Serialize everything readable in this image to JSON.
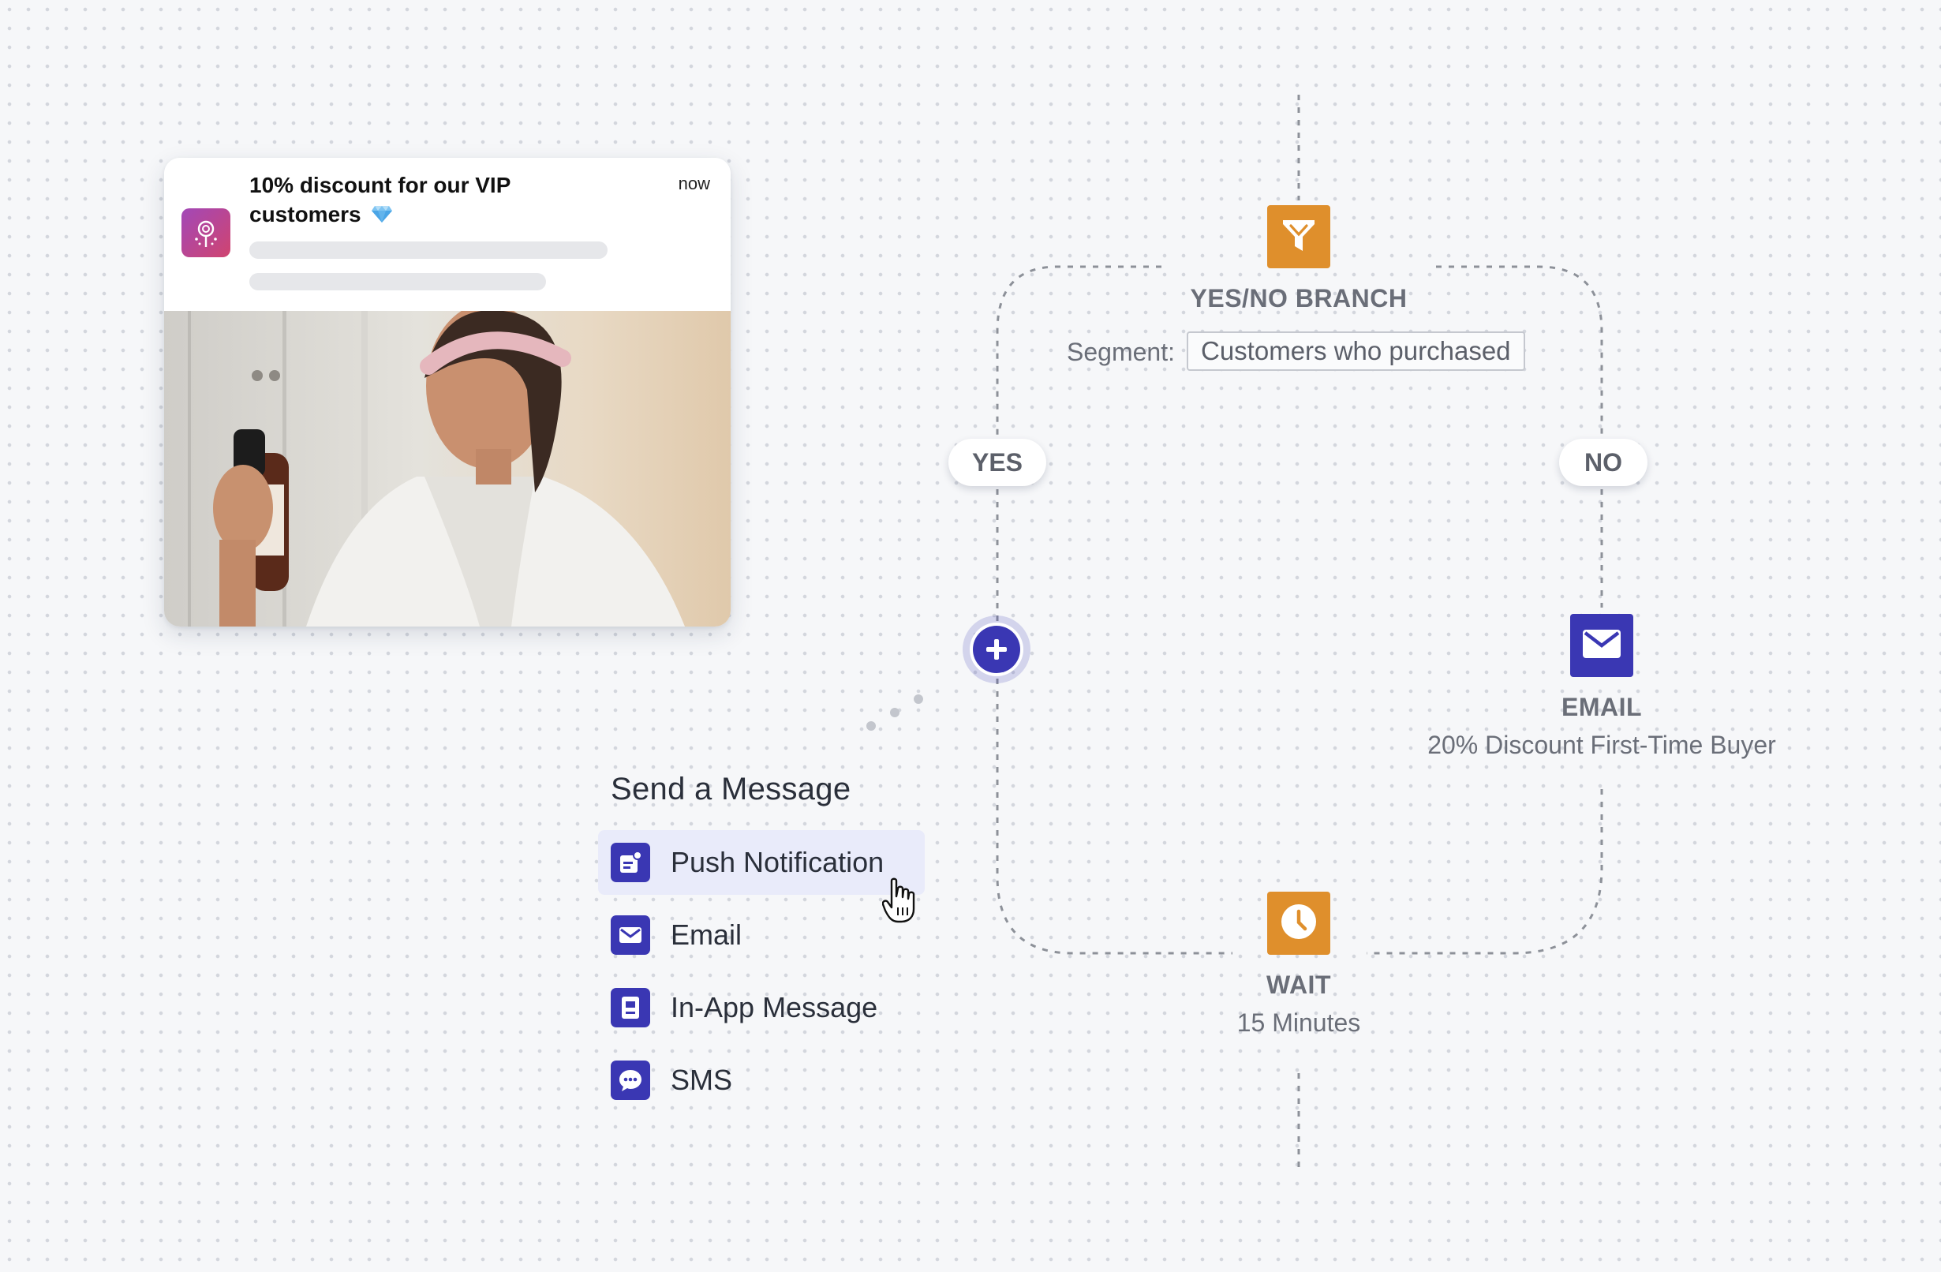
{
  "notification": {
    "title": "10% discount for our VIP customers",
    "time": "now"
  },
  "send_menu": {
    "title": "Send a Message",
    "items": [
      {
        "label": "Push Notification",
        "icon": "push-notification-icon",
        "active": true
      },
      {
        "label": "Email",
        "icon": "envelope-icon",
        "active": false
      },
      {
        "label": "In-App Message",
        "icon": "in-app-message-icon",
        "active": false
      },
      {
        "label": "SMS",
        "icon": "chat-bubble-icon",
        "active": false
      }
    ]
  },
  "flow": {
    "branch": {
      "title": "YES/NO BRANCH",
      "segment_label": "Segment:",
      "segment_value": "Customers who purchased",
      "icon": "filter-icon"
    },
    "yes_label": "YES",
    "no_label": "NO",
    "email_node": {
      "title": "EMAIL",
      "subtitle": "20% Discount First-Time Buyer",
      "icon": "envelope-icon"
    },
    "wait_node": {
      "title": "WAIT",
      "subtitle": "15 Minutes",
      "icon": "clock-icon"
    }
  },
  "colors": {
    "accent": "#3a37b3",
    "node_orange": "#df8f2c",
    "muted_text": "#6a6e78",
    "background": "#f6f7f9"
  }
}
